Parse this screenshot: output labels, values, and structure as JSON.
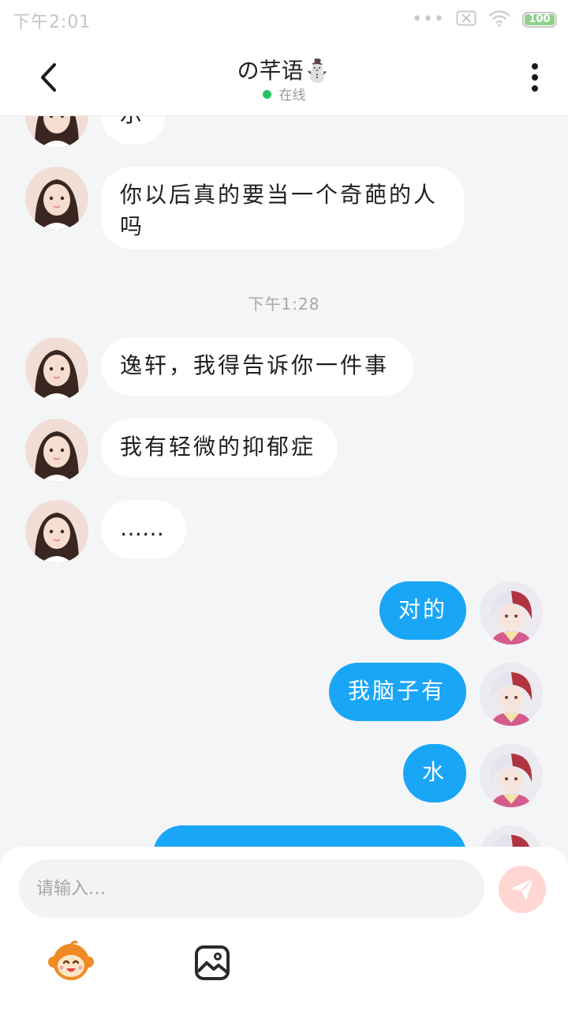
{
  "status_bar": {
    "time": "下午2:01",
    "battery": "100",
    "icons": [
      "signal-dots-icon",
      "no-sim-icon",
      "wifi-icon",
      "battery-icon"
    ]
  },
  "header": {
    "title": "の芊语⛄",
    "status": "在线",
    "back_icon": "chevron-left-icon",
    "menu_icon": "more-vertical-icon"
  },
  "messages": [
    {
      "side": "in",
      "text": "示"
    },
    {
      "side": "in",
      "text": "你以后真的要当一个奇葩的人",
      "text2": "吗"
    },
    {
      "type": "time",
      "text": "下午1:28"
    },
    {
      "side": "in",
      "text": "逸轩，我得告诉你一件事"
    },
    {
      "side": "in",
      "text": "我有轻微的抑郁症"
    },
    {
      "side": "in",
      "text": "……"
    },
    {
      "side": "out",
      "text": "对的"
    },
    {
      "side": "out",
      "text": "我脑子有"
    },
    {
      "side": "out",
      "text": "水"
    },
    {
      "side": "out",
      "text": "…"
    }
  ],
  "input": {
    "placeholder": "请输入…",
    "value": ""
  },
  "toolbar": {
    "send_icon": "paper-plane-icon",
    "emoji_icon": "monkey-sticker-icon",
    "image_icon": "image-icon"
  },
  "colors": {
    "outgoing_bubble": "#1aa6f7",
    "incoming_bubble": "#ffffff",
    "background": "#f4f5f7",
    "online": "#22c55e",
    "send_button": "#ffd6d1"
  }
}
